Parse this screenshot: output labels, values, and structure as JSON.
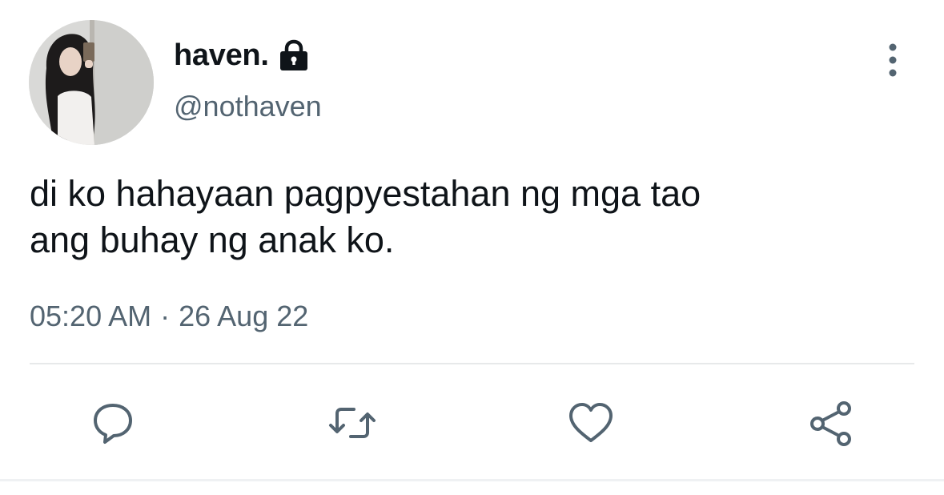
{
  "author": {
    "display_name": "haven.",
    "handle": "@nothaven",
    "protected_icon": "lock-icon",
    "avatar": "profile-photo"
  },
  "tweet": {
    "text_line1": "di ko hahayaan pagpyestahan ng mga tao",
    "text_line2": "ang buhay ng anak ko.",
    "time": "05:20 AM",
    "separator": "·",
    "date": "26 Aug 22"
  },
  "actions": [
    {
      "icon": "reply-icon"
    },
    {
      "icon": "retweet-icon"
    },
    {
      "icon": "like-icon"
    },
    {
      "icon": "share-icon"
    }
  ],
  "menu_icon": "more-vertical-icon",
  "colors": {
    "text": "#0f1419",
    "secondary": "#536471",
    "divider": "#e7e9ea"
  }
}
